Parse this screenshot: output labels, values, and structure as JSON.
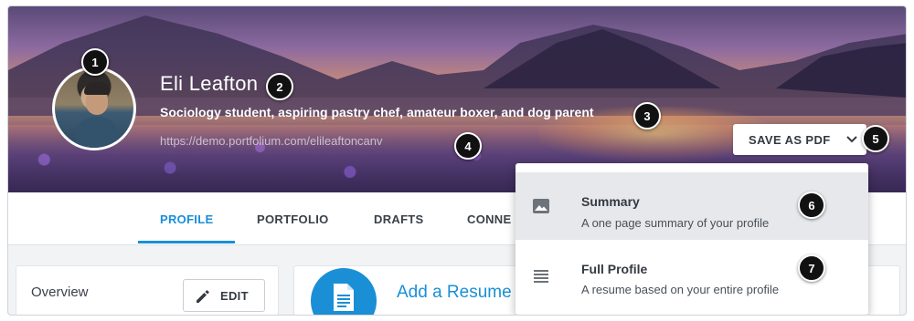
{
  "profile": {
    "name": "Eli Leafton",
    "tagline": "Sociology student, aspiring pastry chef, amateur boxer, and dog parent",
    "url": "https://demo.portfolium.com/elileaftoncanv"
  },
  "actions": {
    "save_pdf_label": "SAVE AS PDF"
  },
  "tabs": [
    {
      "label": "PROFILE",
      "active": true
    },
    {
      "label": "PORTFOLIO",
      "active": false
    },
    {
      "label": "DRAFTS",
      "active": false
    },
    {
      "label": "CONNE",
      "active": false
    }
  ],
  "overview": {
    "label": "Overview",
    "edit_label": "EDIT"
  },
  "resume": {
    "title": "Add a Resume"
  },
  "pdf_menu": {
    "items": [
      {
        "title": "Summary",
        "description": "A one page summary of your profile",
        "icon": "image-icon"
      },
      {
        "title": "Full Profile",
        "description": "A resume based on your entire profile",
        "icon": "list-lines-icon"
      }
    ]
  },
  "callouts": [
    "1",
    "2",
    "3",
    "4",
    "5",
    "6",
    "7"
  ],
  "colors": {
    "accent": "#1a8fd6",
    "callout_bg": "#111111",
    "menu_hover": "#e6e8eb"
  }
}
